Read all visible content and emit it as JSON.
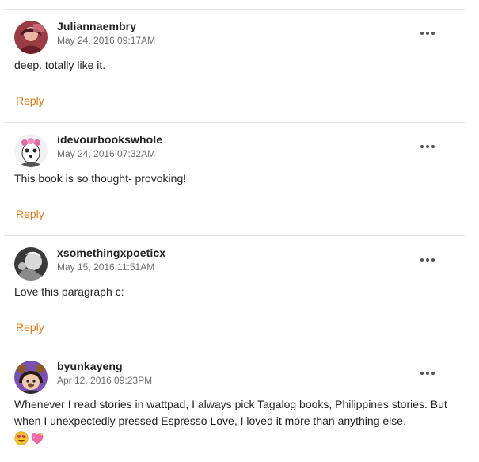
{
  "comments": [
    {
      "username": "Juliannaembry",
      "timestamp": "May 24, 2016 09:17AM",
      "text": "deep. totally like it.",
      "reply_label": "Reply",
      "avatar_icon": "user-avatar-photo"
    },
    {
      "username": "idevourbookswhole",
      "timestamp": "May 24, 2016 07:32AM",
      "text": "This book is so thought- provoking!",
      "reply_label": "Reply",
      "avatar_icon": "user-avatar-photo"
    },
    {
      "username": "xsomethingxpoeticx",
      "timestamp": "May 15, 2016 11:51AM",
      "text": "Love this paragraph c:",
      "reply_label": "Reply",
      "avatar_icon": "user-avatar-photo"
    },
    {
      "username": "byunkayeng",
      "timestamp": "Apr 12, 2016 09:23PM",
      "text": "Whenever I read stories in wattpad, I always pick Tagalog books, Philippines stories. But when I unexpectedly pressed Espresso Love, I loved it more than anything else.",
      "emojis": [
        "heart-eyes-emoji",
        "sparkling-heart-emoji"
      ],
      "avatar_icon": "user-avatar-photo"
    }
  ],
  "colors": {
    "reply": "#e57c12",
    "divider": "#e6e6e6",
    "timestamp": "#6f6f6f"
  },
  "icons": {
    "more_options": "more-options-icon"
  }
}
